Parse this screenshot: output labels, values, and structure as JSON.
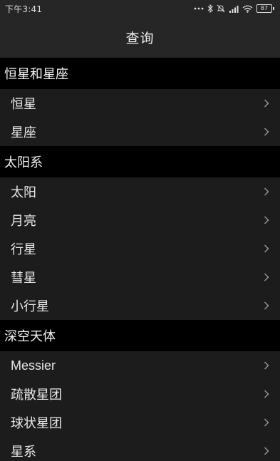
{
  "status_bar": {
    "time": "下午3:41",
    "battery": "87",
    "icons": [
      "more-dots-icon",
      "bluetooth-icon",
      "mute-icon",
      "signal-icon",
      "wifi-icon",
      "battery-icon"
    ]
  },
  "app_bar": {
    "title": "查询"
  },
  "sections": [
    {
      "title": "恒星和星座",
      "items": [
        {
          "label": "恒星"
        },
        {
          "label": "星座"
        }
      ]
    },
    {
      "title": "太阳系",
      "items": [
        {
          "label": "太阳"
        },
        {
          "label": "月亮"
        },
        {
          "label": "行星"
        },
        {
          "label": "彗星"
        },
        {
          "label": "小行星"
        }
      ]
    },
    {
      "title": "深空天体",
      "items": [
        {
          "label": "Messier"
        },
        {
          "label": "疏散星团"
        },
        {
          "label": "球状星团"
        },
        {
          "label": "星系"
        }
      ]
    }
  ],
  "colors": {
    "background": "#1c1c1c",
    "section_header": "#000000",
    "app_bar": "#262626",
    "text": "#e8e8e8",
    "chevron": "#9a9a9a"
  }
}
